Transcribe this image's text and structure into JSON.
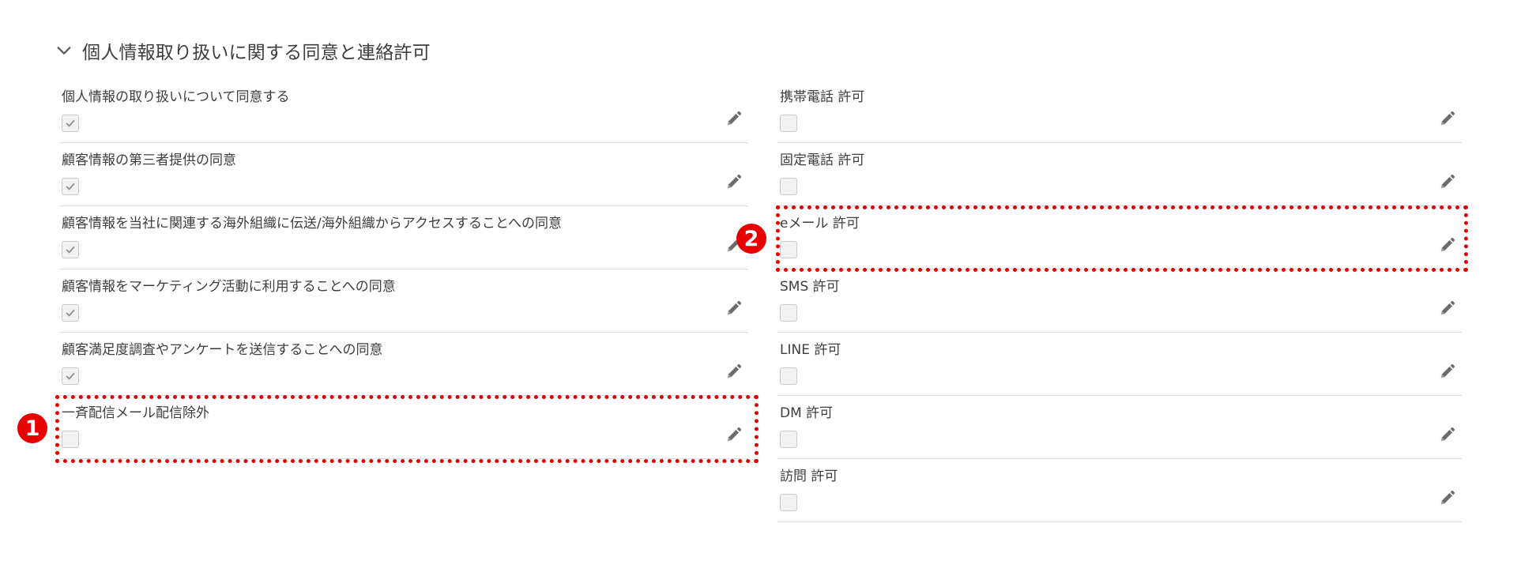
{
  "section": {
    "title": "個人情報取り扱いに関する同意と連絡許可",
    "chevron_icon": "chevron-down-icon"
  },
  "left_fields": [
    {
      "label": "個人情報の取り扱いについて同意する",
      "checked": true
    },
    {
      "label": "顧客情報の第三者提供の同意",
      "checked": true
    },
    {
      "label": "顧客情報を当社に関連する海外組織に伝送/海外組織からアクセスすることへの同意",
      "checked": true
    },
    {
      "label": "顧客情報をマーケティング活動に利用することへの同意",
      "checked": true
    },
    {
      "label": "顧客満足度調査やアンケートを送信することへの同意",
      "checked": true
    },
    {
      "label": "一斉配信メール配信除外",
      "checked": false
    }
  ],
  "right_fields": [
    {
      "label": "携帯電話 許可",
      "checked": false
    },
    {
      "label": "固定電話 許可",
      "checked": false
    },
    {
      "label": "eメール 許可",
      "checked": false
    },
    {
      "label": "SMS 許可",
      "checked": false
    },
    {
      "label": "LINE 許可",
      "checked": false
    },
    {
      "label": "DM 許可",
      "checked": false
    },
    {
      "label": "訪問 許可",
      "checked": false
    }
  ],
  "markers": {
    "one": "1",
    "two": "2"
  },
  "colors": {
    "highlight": "#e00000",
    "marker": "#e60000",
    "divider": "#d8dde6",
    "checkmark": "#8c8c8c",
    "pencil": "#6b6b6b"
  }
}
